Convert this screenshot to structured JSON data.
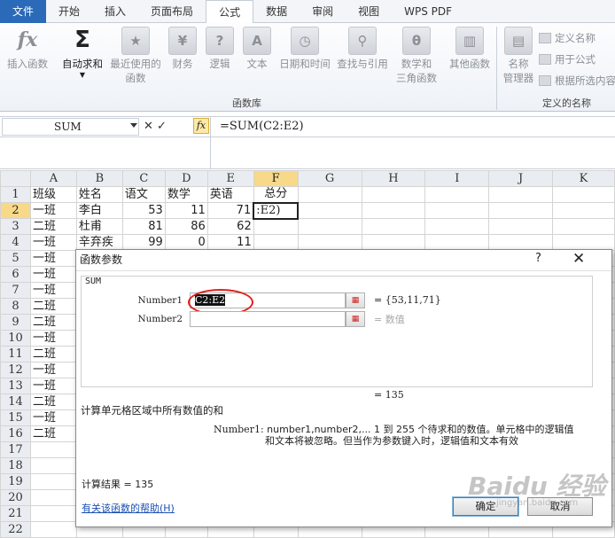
{
  "tabs": [
    "文件",
    "开始",
    "插入",
    "页面布局",
    "公式",
    "数据",
    "审阅",
    "视图",
    "WPS PDF"
  ],
  "ribbon": {
    "insert_function": {
      "icon": "fx",
      "label": "插入函数"
    },
    "autosum": {
      "icon": "Σ",
      "label": "自动求和"
    },
    "recent": {
      "label1": "最近使用的",
      "label2": "函数"
    },
    "finance": {
      "label": "财务"
    },
    "logic": {
      "label": "逻辑"
    },
    "text": {
      "label": "文本"
    },
    "datetime": {
      "label": "日期和时间"
    },
    "lookup": {
      "label": "查找与引用"
    },
    "math": {
      "label1": "数学和",
      "label2": "三角函数"
    },
    "more": {
      "label": "其他函数"
    },
    "name_mgr": {
      "label1": "名称",
      "label2": "管理器"
    },
    "define_name": "定义名称",
    "use_in_formula": "用于公式",
    "create_from_sel": "根据所选内容",
    "group_library": "函数库",
    "group_names": "定义的名称"
  },
  "formula_bar": {
    "name_box": "SUM",
    "formula": "=SUM(C2:E2)",
    "fx": "fx",
    "cancel": "✕",
    "enter": "✓"
  },
  "columns": [
    "A",
    "B",
    "C",
    "D",
    "E",
    "F",
    "G",
    "H",
    "I",
    "J",
    "K"
  ],
  "rows": [
    {
      "n": "1",
      "A": "班级",
      "B": "姓名",
      "C": "语文",
      "D": "数学",
      "E": "英语",
      "F": "总分"
    },
    {
      "n": "2",
      "A": "一班",
      "B": "李白",
      "C": "53",
      "D": "11",
      "E": "71",
      "F": ":E2)"
    },
    {
      "n": "3",
      "A": "二班",
      "B": "杜甫",
      "C": "81",
      "D": "86",
      "E": "62",
      "F": ""
    },
    {
      "n": "4",
      "A": "一班",
      "B": "辛弃疾",
      "C": "99",
      "D": "0",
      "E": "11",
      "F": ""
    },
    {
      "n": "5",
      "A": "一班",
      "B": "",
      "C": "",
      "D": "",
      "E": "",
      "F": ""
    },
    {
      "n": "6",
      "A": "一班",
      "B": "",
      "C": "",
      "D": "",
      "E": "",
      "F": ""
    },
    {
      "n": "7",
      "A": "一班",
      "B": "",
      "C": "",
      "D": "",
      "E": "",
      "F": ""
    },
    {
      "n": "8",
      "A": "二班",
      "B": "",
      "C": "",
      "D": "",
      "E": "",
      "F": ""
    },
    {
      "n": "9",
      "A": "二班",
      "B": "",
      "C": "",
      "D": "",
      "E": "",
      "F": ""
    },
    {
      "n": "10",
      "A": "一班",
      "B": "",
      "C": "",
      "D": "",
      "E": "",
      "F": ""
    },
    {
      "n": "11",
      "A": "二班",
      "B": "",
      "C": "",
      "D": "",
      "E": "",
      "F": ""
    },
    {
      "n": "12",
      "A": "一班",
      "B": "",
      "C": "",
      "D": "",
      "E": "",
      "F": ""
    },
    {
      "n": "13",
      "A": "一班",
      "B": "",
      "C": "",
      "D": "",
      "E": "",
      "F": ""
    },
    {
      "n": "14",
      "A": "二班",
      "B": "",
      "C": "",
      "D": "",
      "E": "",
      "F": ""
    },
    {
      "n": "15",
      "A": "一班",
      "B": "",
      "C": "",
      "D": "",
      "E": "",
      "F": ""
    },
    {
      "n": "16",
      "A": "二班",
      "B": "",
      "C": "",
      "D": "",
      "E": "",
      "F": ""
    },
    {
      "n": "17",
      "A": "",
      "B": "",
      "C": "",
      "D": "",
      "E": "",
      "F": ""
    },
    {
      "n": "18",
      "A": "",
      "B": "",
      "C": "",
      "D": "",
      "E": "",
      "F": ""
    },
    {
      "n": "19",
      "A": "",
      "B": "",
      "C": "",
      "D": "",
      "E": "",
      "F": ""
    },
    {
      "n": "20",
      "A": "",
      "B": "",
      "C": "",
      "D": "",
      "E": "",
      "F": ""
    },
    {
      "n": "21",
      "A": "",
      "B": "",
      "C": "",
      "D": "",
      "E": "",
      "F": ""
    },
    {
      "n": "22",
      "A": "",
      "B": "",
      "C": "",
      "D": "",
      "E": "",
      "F": ""
    }
  ],
  "dialog": {
    "title": "函数参数",
    "help": "?",
    "close": "✕",
    "func": "SUM",
    "arg1_label": "Number1",
    "arg1_value": "C2:E2",
    "arg1_result": "= {53,11,71}",
    "arg2_label": "Number2",
    "arg2_result": "= 数值",
    "total": "= 135",
    "description": "计算单元格区域中所有数值的和",
    "arg_name": "Number1:",
    "arg_desc1": "number1,number2,... 1 到 255 个待求和的数值。单元格中的逻辑值",
    "arg_desc2": "和文本将被忽略。但当作为参数键入时，逻辑值和文本有效",
    "result_label": "计算结果 = 135",
    "help_link": "有关该函数的帮助(H)",
    "ok": "确定",
    "cancel": "取消"
  },
  "watermark": "Baidu 经验",
  "watermark_url": "jingyan.baidu.com"
}
